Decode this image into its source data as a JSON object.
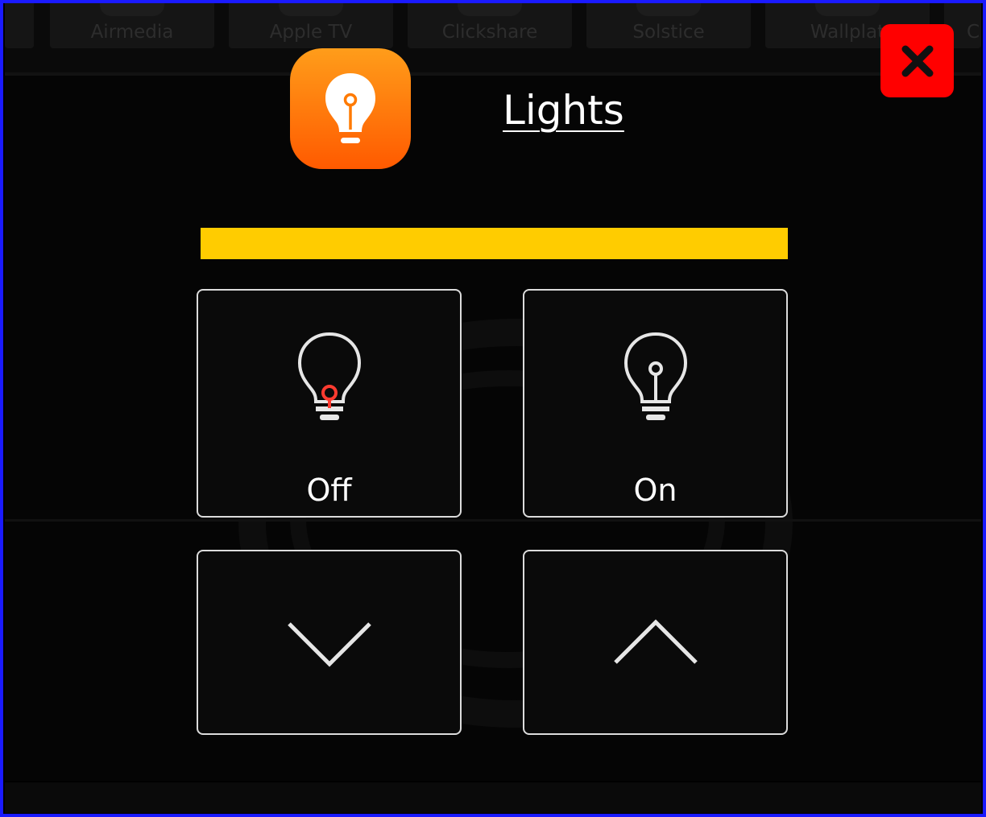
{
  "background_apps": [
    {
      "label": "Airmedia"
    },
    {
      "label": "Apple TV"
    },
    {
      "label": "Clickshare"
    },
    {
      "label": "Solstice"
    },
    {
      "label": "Wallplat"
    },
    {
      "label": "C"
    }
  ],
  "dialog": {
    "title": "Lights",
    "app_icon": "lightbulb-icon",
    "level_percent": 100,
    "level_color": "#ffcc00",
    "close_icon": "close-icon",
    "close_color": "#ff0000",
    "buttons": {
      "off": {
        "label": "Off",
        "icon": "lightbulb-off-icon",
        "accent": "#ff3b30"
      },
      "on": {
        "label": "On",
        "icon": "lightbulb-on-icon"
      },
      "down": {
        "icon": "chevron-down-icon"
      },
      "up": {
        "icon": "chevron-up-icon"
      }
    }
  }
}
